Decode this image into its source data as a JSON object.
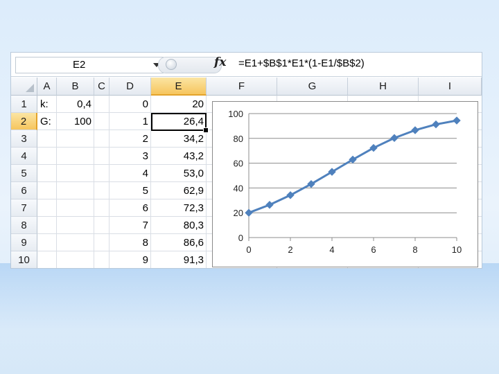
{
  "formula_bar": {
    "name_box": "E2",
    "fx_label": "fx",
    "formula": "=E1+$B$1*E1*(1-E1/$B$2)"
  },
  "columns": [
    "A",
    "B",
    "C",
    "D",
    "E",
    "F",
    "G",
    "H",
    "I"
  ],
  "active_column": "E",
  "rows": [
    "1",
    "2",
    "3",
    "4",
    "5",
    "6",
    "7",
    "8",
    "9",
    "10"
  ],
  "active_row": "2",
  "cells": {
    "A": [
      "k:",
      "G:"
    ],
    "B": [
      "0,4",
      "100"
    ],
    "D": [
      "0",
      "1",
      "2",
      "3",
      "4",
      "5",
      "6",
      "7",
      "8",
      "9"
    ],
    "E": [
      "20",
      "26,4",
      "34,2",
      "43,2",
      "53,0",
      "62,9",
      "72,3",
      "80,3",
      "86,6",
      "91,3"
    ]
  },
  "accent_color": "#4f81bd",
  "chart_data": {
    "type": "line",
    "x": [
      0,
      1,
      2,
      3,
      4,
      5,
      6,
      7,
      8,
      9,
      10
    ],
    "series": [
      {
        "values": [
          20,
          26.4,
          34.2,
          43.2,
          53.0,
          62.9,
          72.3,
          80.3,
          86.6,
          91.3,
          94.4
        ]
      }
    ],
    "xlim": [
      0,
      10
    ],
    "ylim": [
      0,
      100
    ],
    "xticks": [
      "0",
      "2",
      "4",
      "6",
      "8",
      "10"
    ],
    "yticks": [
      "0",
      "20",
      "40",
      "60",
      "80",
      "100"
    ],
    "grid": "horizontal",
    "legend": "none",
    "marker": "diamond"
  }
}
